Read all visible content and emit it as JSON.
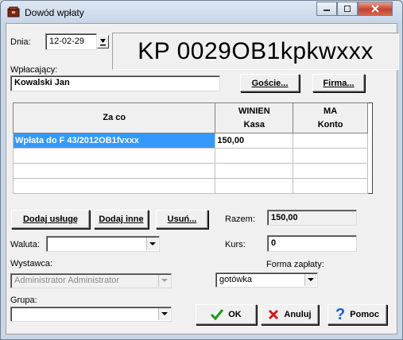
{
  "window": {
    "title": "Dowód wpłaty"
  },
  "header": {
    "date_label": "Dnia:",
    "date_value": "12-02-29",
    "document_number": "KP 0029OB1kpkwxxx"
  },
  "payer": {
    "label": "Wpłacający:",
    "value": "Kowalski Jan",
    "guests_button": "Goście...",
    "company_button": "Firma..."
  },
  "table": {
    "columns": [
      {
        "line1": "Za co",
        "line2": ""
      },
      {
        "line1": "WINIEN",
        "line2": "Kasa"
      },
      {
        "line1": "MA",
        "line2": "Konto"
      }
    ],
    "rows": [
      [
        "Wpłata do F 43/2012OB1fvxxx",
        "150,00",
        ""
      ],
      [
        "",
        "",
        ""
      ],
      [
        "",
        "",
        ""
      ],
      [
        "",
        "",
        ""
      ]
    ]
  },
  "actions": {
    "add_service": "Dodaj usługę",
    "add_other": "Dodaj inne",
    "remove": "Usuń..."
  },
  "summary": {
    "amount_label": "Razem:",
    "amount_value": "150,00",
    "rate_label": "Kurs:",
    "rate_value": "0"
  },
  "currency": {
    "label": "Waluta:",
    "value": ""
  },
  "issuer": {
    "label": "Wystawca:",
    "value": "Administrator Administrator"
  },
  "payment": {
    "label": "Forma zapłaty:",
    "value": "gotówka"
  },
  "group": {
    "label": "Grupa:",
    "value": ""
  },
  "footer": {
    "ok": "OK",
    "cancel": "Anuluj",
    "help": "Pomoc"
  },
  "colors": {
    "selection": "#3399ff",
    "ok_check": "#1a9a1a",
    "cancel_x": "#d01818",
    "help_q": "#1a5fd0"
  }
}
